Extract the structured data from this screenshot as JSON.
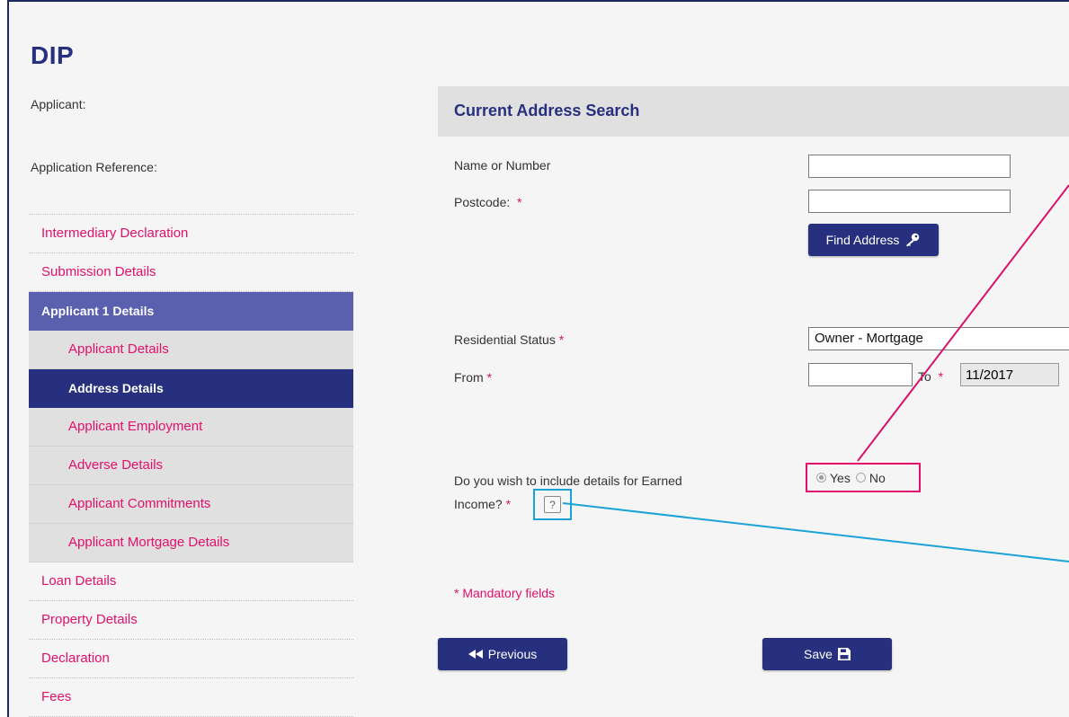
{
  "app": {
    "title": "DIP"
  },
  "meta": {
    "applicant_label": "Applicant:",
    "reference_label": "Application Reference:"
  },
  "sidebar": {
    "items": [
      {
        "label": "Intermediary Declaration"
      },
      {
        "label": "Submission Details"
      },
      {
        "label": "Applicant 1 Details"
      },
      {
        "label": "Applicant Details"
      },
      {
        "label": "Address Details"
      },
      {
        "label": "Applicant Employment"
      },
      {
        "label": "Adverse Details"
      },
      {
        "label": "Applicant Commitments"
      },
      {
        "label": "Applicant Mortgage Details"
      },
      {
        "label": "Loan Details"
      },
      {
        "label": "Property Details"
      },
      {
        "label": "Declaration"
      },
      {
        "label": "Fees"
      }
    ]
  },
  "main": {
    "section_title": "Current Address Search",
    "name_label": "Name or Number",
    "name_value": "",
    "postcode_label": "Postcode:",
    "postcode_value": "",
    "required_marker": "*",
    "find_address_label": "Find Address",
    "residential_status_label": "Residential Status",
    "residential_status_value": "Owner - Mortgage",
    "from_label": "From",
    "from_value": "",
    "to_label": "To",
    "to_value": "11/2017",
    "earned_income_question_line1": "Do you wish to include details for Earned",
    "earned_income_question_line2": "Income?",
    "radio_yes": "Yes",
    "radio_no": "No",
    "help_glyph": "?",
    "mandatory_note": "* Mandatory fields",
    "previous_label": "Previous",
    "save_label": "Save"
  },
  "colors": {
    "accent_pink": "#e2106a",
    "navy": "#27307e",
    "group_purple": "#5a5fae",
    "callout_cyan": "#1ba3d6"
  },
  "icons": {
    "find": "key-icon",
    "previous": "rewind-icon",
    "save": "floppy-disk-icon",
    "help": "help-icon"
  }
}
